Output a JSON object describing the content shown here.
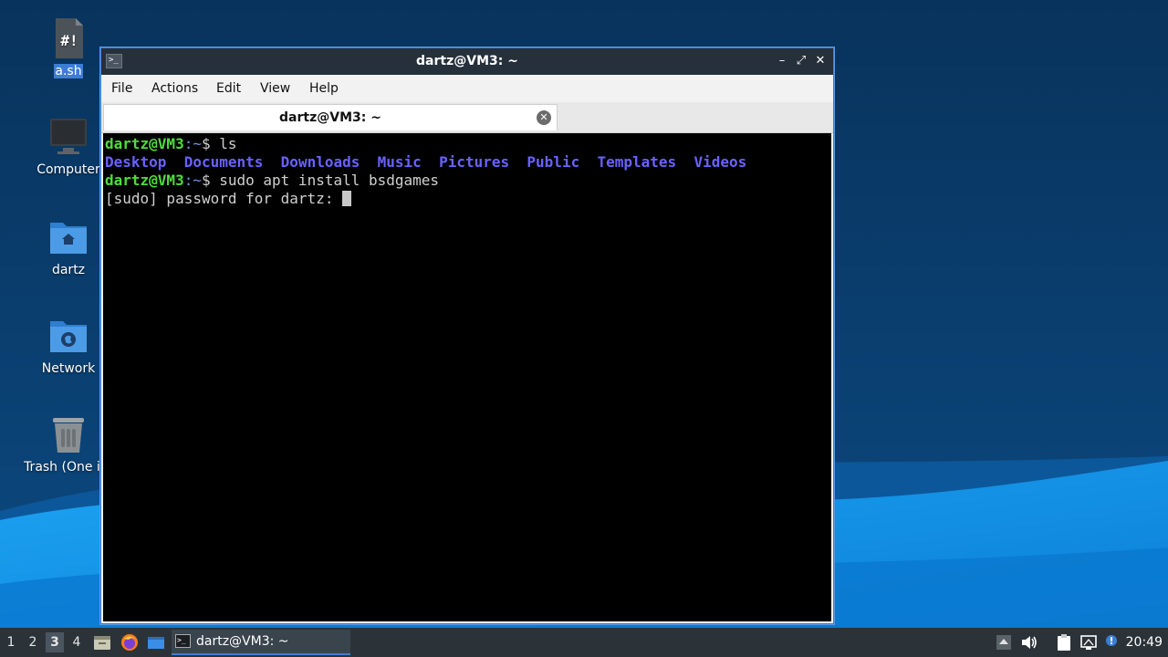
{
  "desktop": {
    "icons": [
      {
        "label": "a.sh",
        "icon": "script-file-icon"
      },
      {
        "label": "Computer",
        "icon": "computer-icon"
      },
      {
        "label": "dartz",
        "icon": "home-folder-icon"
      },
      {
        "label": "Network",
        "icon": "network-folder-icon"
      },
      {
        "label": "Trash (One ite",
        "icon": "trash-icon"
      }
    ]
  },
  "window": {
    "title": "dartz@VM3: ~",
    "menu": [
      "File",
      "Actions",
      "Edit",
      "View",
      "Help"
    ],
    "tab_label": "dartz@VM3: ~",
    "terminal": {
      "prompt_user": "dartz@VM3",
      "prompt_path": ":~",
      "prompt_symbol": "$ ",
      "cmd1": "ls",
      "ls_output": [
        "Desktop",
        "Documents",
        "Downloads",
        "Music",
        "Pictures",
        "Public",
        "Templates",
        "Videos"
      ],
      "cmd2": "sudo apt install bsdgames",
      "sudo_prompt": "[sudo] password for dartz: "
    }
  },
  "taskbar": {
    "workspaces": [
      "1",
      "2",
      "3",
      "4"
    ],
    "active_workspace": "3",
    "task_label": "dartz@VM3: ~",
    "clock": "20:49"
  },
  "colors": {
    "prompt_user": "#4fdc3c",
    "directory": "#6a62ff",
    "accent": "#3c7fd4"
  }
}
